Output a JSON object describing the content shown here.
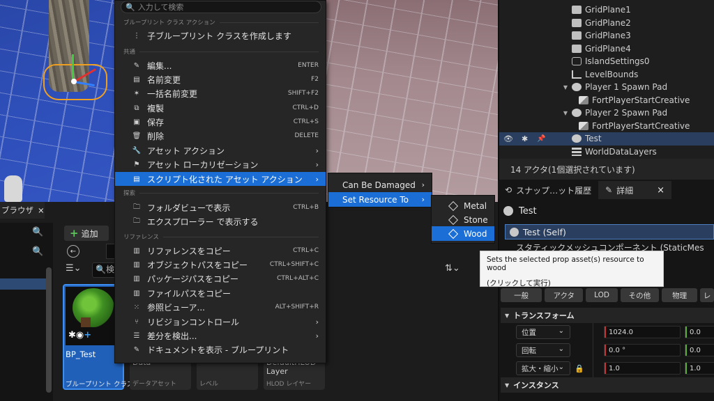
{
  "outliner": {
    "rows": [
      {
        "label": "GridPlane1",
        "icon": "grid-icon"
      },
      {
        "label": "GridPlane2",
        "icon": "grid-icon"
      },
      {
        "label": "GridPlane3",
        "icon": "grid-icon"
      },
      {
        "label": "GridPlane4",
        "icon": "grid-icon"
      },
      {
        "label": "IslandSettings0",
        "icon": "island-icon"
      },
      {
        "label": "LevelBounds",
        "icon": "bounds-icon"
      },
      {
        "label": "Player 1 Spawn Pad",
        "icon": "spawn-pad-icon"
      },
      {
        "label": "FortPlayerStartCreative",
        "icon": "player-start-icon"
      },
      {
        "label": "Player 2 Spawn Pad",
        "icon": "spawn-pad-icon"
      },
      {
        "label": "FortPlayerStartCreative",
        "icon": "player-start-icon"
      },
      {
        "label": "Test",
        "icon": "spawn-pad-icon"
      },
      {
        "label": "WorldDataLayers",
        "icon": "layers-icon"
      }
    ],
    "actor_count": "14 アクタ(1個選択されています)"
  },
  "details": {
    "tabs": [
      {
        "label": "スナップ…ット履歴"
      },
      {
        "label": "詳細",
        "close": "×"
      }
    ],
    "title": "Test",
    "self_row": "Test (Self)",
    "component_row": "スタティックメッシュコンポーネント (StaticMes",
    "tooltip": {
      "line1": "Sets the selected prop asset(s) resource to wood",
      "line2": "(クリックして実行)"
    },
    "categories": [
      "一般",
      "アクタ",
      "LOD",
      "その他",
      "物理",
      "レ"
    ],
    "sections": {
      "transform": "トランスフォーム",
      "instance": "インスタンス"
    },
    "transform": {
      "location_label": "位置",
      "rotation_label": "回転",
      "scale_label": "拡大・縮小",
      "location": {
        "x": "1024.0",
        "y": "0.0"
      },
      "rotation": {
        "x": "0.0 °",
        "y": "0.0"
      },
      "scale": {
        "x": "1.0",
        "y": "1.0"
      }
    }
  },
  "content_browser": {
    "tab_label": "ブラウザ",
    "tab_close": "×",
    "add_label": "追加",
    "search_placeholder": "検",
    "tiles": [
      {
        "name": "BP_Test",
        "type": "ブループリント クラス"
      },
      {
        "name": "Data",
        "type": "データアセット"
      },
      {
        "name": "",
        "type": "レベル"
      },
      {
        "name": "DefaultHLOD Layer",
        "type": "HLOD レイヤー"
      }
    ]
  },
  "context_menu": {
    "search_placeholder": "入力して検索",
    "sections": {
      "blueprint": "ブループリント クラス アクション",
      "common": "共通",
      "explore": "探索",
      "references": "リファレンス"
    },
    "items": [
      {
        "label": "子ブループリント クラスを作成します",
        "shortcut": "",
        "icon": "child-class-icon"
      },
      {
        "label": "編集...",
        "shortcut": "ENTER",
        "icon": "edit-icon"
      },
      {
        "label": "名前変更",
        "shortcut": "F2",
        "icon": "rename-icon"
      },
      {
        "label": "一括名前変更",
        "shortcut": "SHIFT+F2",
        "icon": "bulk-rename-icon"
      },
      {
        "label": "複製",
        "shortcut": "CTRL+D",
        "icon": "duplicate-icon"
      },
      {
        "label": "保存",
        "shortcut": "CTRL+S",
        "icon": "save-icon"
      },
      {
        "label": "削除",
        "shortcut": "DELETE",
        "icon": "delete-icon"
      },
      {
        "label": "アセット アクション",
        "shortcut": "",
        "icon": "wrench-icon"
      },
      {
        "label": "アセット ローカリゼーション",
        "shortcut": "",
        "icon": "flag-icon"
      },
      {
        "label": "スクリプト化された アセット アクション",
        "shortcut": "",
        "icon": "script-icon"
      },
      {
        "label": "フォルダビューで表示",
        "shortcut": "CTRL+B",
        "icon": "folder-view-icon"
      },
      {
        "label": "エクスプローラー で表示する",
        "shortcut": "",
        "icon": "explorer-icon"
      },
      {
        "label": "リファレンスをコピー",
        "shortcut": "CTRL+C",
        "icon": "copy-reference-icon"
      },
      {
        "label": "オブジェクトパスをコピー",
        "shortcut": "CTRL+SHIFT+C",
        "icon": "copy-object-path-icon"
      },
      {
        "label": "パッケージパスをコピー",
        "shortcut": "CTRL+ALT+C",
        "icon": "copy-package-path-icon"
      },
      {
        "label": "ファイルパスをコピー",
        "shortcut": "",
        "icon": "copy-file-path-icon"
      },
      {
        "label": "参照ビューア...",
        "shortcut": "ALT+SHIFT+R",
        "icon": "reference-viewer-icon"
      },
      {
        "label": "リビジョンコントロール",
        "shortcut": "",
        "icon": "revision-icon"
      },
      {
        "label": "差分を検出...",
        "shortcut": "",
        "icon": "diff-icon"
      },
      {
        "label": "ドキュメントを表示 - ブループリント",
        "shortcut": "",
        "icon": "docs-icon"
      }
    ]
  },
  "submenu1": {
    "items": [
      "Can Be Damaged",
      "Set Resource To"
    ]
  },
  "submenu2": {
    "items": [
      "Metal",
      "Stone",
      "Wood"
    ]
  },
  "colors": {
    "highlight": "#1b6ed6",
    "selection_outline": "#f0a020",
    "axis_x": "#c83232",
    "axis_y": "#5ab032"
  }
}
